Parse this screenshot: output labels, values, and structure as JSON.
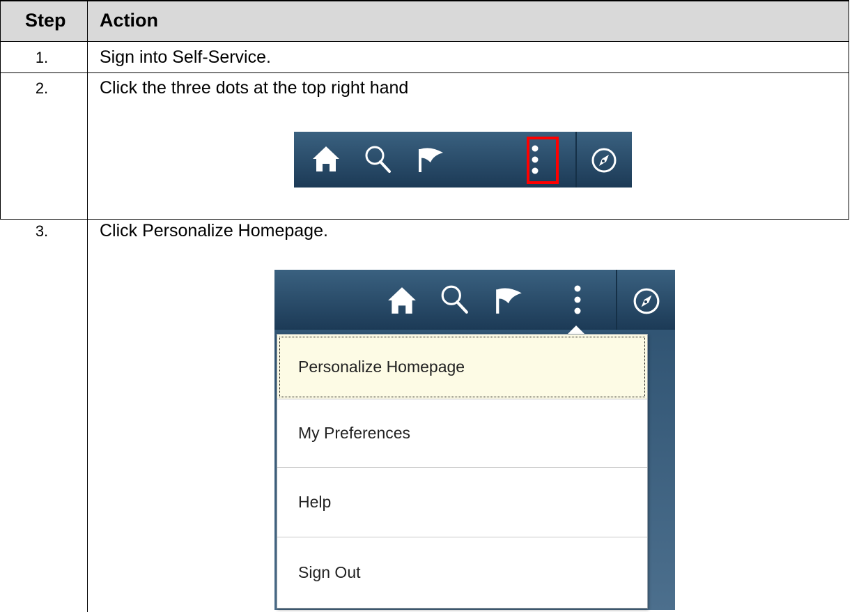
{
  "table": {
    "header": {
      "step": "Step",
      "action": "Action"
    },
    "rows": [
      {
        "step": "1.",
        "action": "Sign into Self-Service."
      },
      {
        "step": "2.",
        "action": "Click the three dots at the top right hand"
      },
      {
        "step": "3.",
        "action": "Click Personalize Homepage."
      }
    ]
  },
  "nav_icons": [
    "home-icon",
    "search-icon",
    "flag-icon",
    "more-dots-icon",
    "compass-icon"
  ],
  "menu": {
    "items": [
      "Personalize Homepage",
      "My Preferences",
      "Help",
      "Sign Out"
    ],
    "active_index": 0
  },
  "colors": {
    "header_bg": "#d9d9d9",
    "navbar": "#1c3a56",
    "highlight": "#ff0000",
    "menu_active": "#fdfbe5"
  }
}
